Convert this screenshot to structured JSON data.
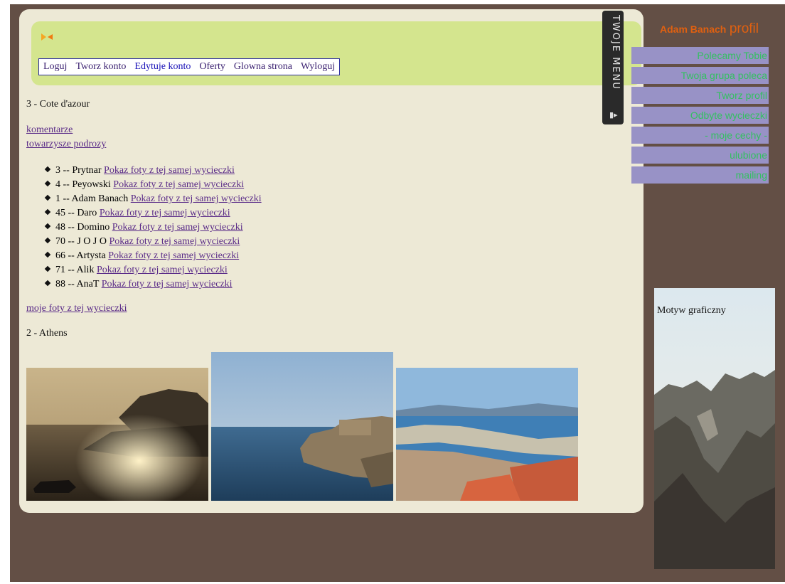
{
  "nav": [
    "Loguj",
    "Tworz konto",
    "Edytuje konto",
    "Oferty",
    "Glowna strona",
    "Wyloguj"
  ],
  "trip_current": "3 - Cote d'azour",
  "links": {
    "comments": "komentarze",
    "companions": "towarzysze podrozy",
    "my_photos": "moje foty z tej wycieczki"
  },
  "companions": [
    {
      "text": "3 -- Prytnar",
      "link": "Pokaz foty z tej samej wycieczki"
    },
    {
      "text": "4 -- Peyowski",
      "link": "Pokaz foty z tej samej wycieczki"
    },
    {
      "text": "1 -- Adam Banach",
      "link": "Pokaz foty z tej samej wycieczki"
    },
    {
      "text": "45 -- Daro",
      "link": "Pokaz foty z tej samej wycieczki"
    },
    {
      "text": "48 -- Domino",
      "link": "Pokaz foty z tej samej wycieczki"
    },
    {
      "text": "70 -- J O J O",
      "link": "Pokaz foty z tej samej wycieczki"
    },
    {
      "text": "66 -- Artysta",
      "link": "Pokaz foty z tej samej wycieczki"
    },
    {
      "text": "71 -- Alik",
      "link": "Pokaz foty z tej samej wycieczki"
    },
    {
      "text": "88 -- AnaT",
      "link": "Pokaz foty z tej samej wycieczki"
    }
  ],
  "trip_next": "2 - Athens",
  "menu_tab": "TWOJE MENU",
  "profile": {
    "name": "Adam Banach",
    "label": "profil"
  },
  "side_menu": [
    "Polecamy Tobie",
    "Twoja grupa poleca",
    "Tworz profil",
    "Odbyte wycieczki",
    "- moje cechy -",
    "ulubione",
    "mailing"
  ],
  "motyw_label": "Motyw graficzny",
  "colors": {
    "accent": "#e06010",
    "menu_bg": "#9892c6",
    "menu_text": "#33c060",
    "header_bg": "#d4e58e"
  }
}
